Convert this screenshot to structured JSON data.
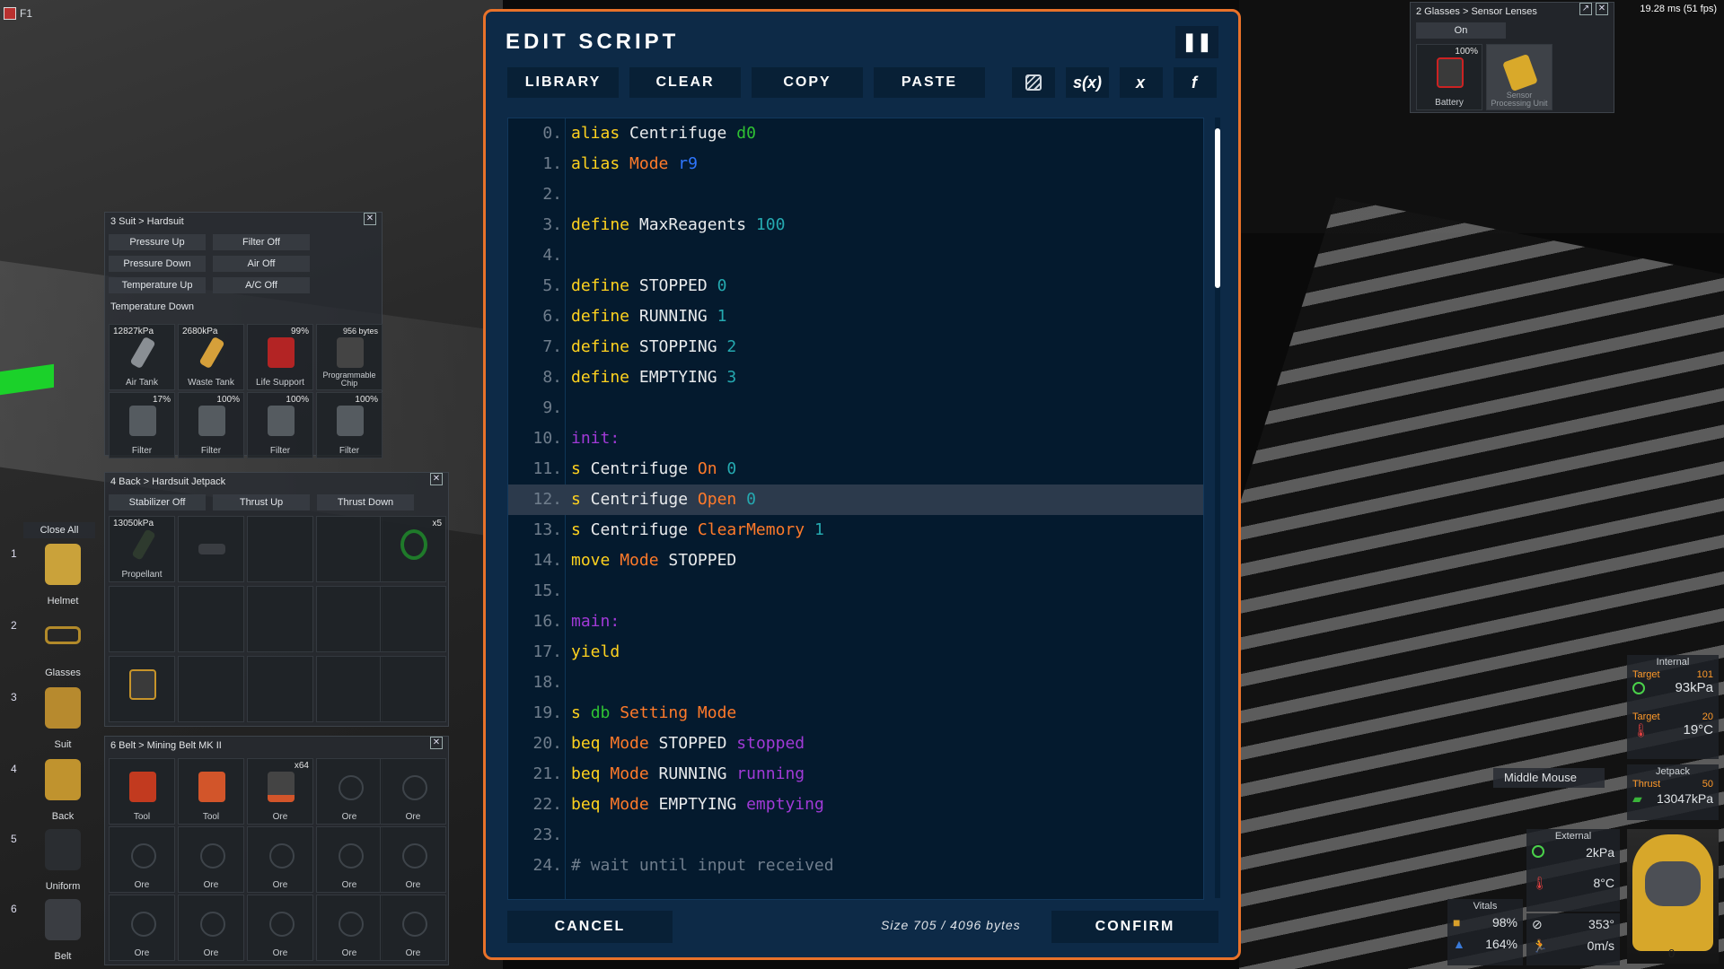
{
  "top_left": {
    "key": "F1"
  },
  "fps": "19.28 ms (51 fps)",
  "glasses_panel": {
    "title": "2 Glasses > Sensor Lenses",
    "toggle": "On",
    "slots": [
      {
        "label": "Battery",
        "value": "100%"
      },
      {
        "label": "Sensor Processing Unit",
        "value": ""
      }
    ]
  },
  "suit_panel": {
    "title": "3 Suit > Hardsuit",
    "buttons": [
      "Pressure Up",
      "Filter Off",
      "Pressure Down",
      "Air Off",
      "Temperature Up",
      "A/C Off",
      "Temperature Down"
    ],
    "slots": [
      {
        "label": "Air Tank",
        "value": "12827kPa"
      },
      {
        "label": "Waste Tank",
        "value": "2680kPa"
      },
      {
        "label": "Life Support",
        "value": "99%"
      },
      {
        "label": "Programmable Chip",
        "value": "956 bytes"
      },
      {
        "label": "Filter",
        "value": "17%"
      },
      {
        "label": "Filter",
        "value": "100%"
      },
      {
        "label": "Filter",
        "value": "100%"
      },
      {
        "label": "Filter",
        "value": "100%"
      }
    ]
  },
  "jetpack_panel": {
    "title": "4 Back > Hardsuit Jetpack",
    "buttons": [
      "Stabilizer Off",
      "Thrust Up",
      "Thrust Down"
    ],
    "slots": [
      {
        "label": "Propellant",
        "value": "13050kPa"
      },
      {
        "label": "",
        "value": "x5"
      }
    ]
  },
  "belt_panel": {
    "title": "6 Belt > Mining Belt MK II",
    "slots": [
      "Tool",
      "Tool",
      "Ore",
      "Ore",
      "Ore",
      "Ore",
      "Ore",
      "Ore",
      "Ore",
      "Ore",
      "Ore",
      "Ore",
      "Ore",
      "Ore",
      "Ore"
    ],
    "ore_count": "x64"
  },
  "close_all": "Close All",
  "left_bar": [
    {
      "num": "1",
      "label": "Helmet"
    },
    {
      "num": "2",
      "label": "Glasses"
    },
    {
      "num": "3",
      "label": "Suit"
    },
    {
      "num": "4",
      "label": "Back"
    },
    {
      "num": "5",
      "label": "Uniform"
    },
    {
      "num": "6",
      "label": "Belt"
    }
  ],
  "dialog": {
    "title": "EDIT SCRIPT",
    "toolbar": {
      "library": "LIBRARY",
      "clear": "CLEAR",
      "copy": "COPY",
      "paste": "PASTE",
      "sx": "s(x)",
      "x": "x",
      "f": "f"
    },
    "cancel": "CANCEL",
    "confirm": "CONFIRM",
    "size": "Size 705 / 4096 bytes",
    "highlighted_line": 12,
    "lines": [
      [
        [
          "kw",
          "alias"
        ],
        [
          "id",
          " Centrifuge "
        ],
        [
          "dev",
          "d0"
        ]
      ],
      [
        [
          "kw",
          "alias"
        ],
        [
          "id",
          " "
        ],
        [
          "lg",
          "Mode"
        ],
        [
          "id",
          " "
        ],
        [
          "reg",
          "r9"
        ]
      ],
      [],
      [
        [
          "kw",
          "define"
        ],
        [
          "id",
          " MaxReagents "
        ],
        [
          "num",
          "100"
        ]
      ],
      [],
      [
        [
          "kw",
          "define"
        ],
        [
          "id",
          " STOPPED "
        ],
        [
          "num",
          "0"
        ]
      ],
      [
        [
          "kw",
          "define"
        ],
        [
          "id",
          " RUNNING "
        ],
        [
          "num",
          "1"
        ]
      ],
      [
        [
          "kw",
          "define"
        ],
        [
          "id",
          " STOPPING "
        ],
        [
          "num",
          "2"
        ]
      ],
      [
        [
          "kw",
          "define"
        ],
        [
          "id",
          " EMPTYING "
        ],
        [
          "num",
          "3"
        ]
      ],
      [],
      [
        [
          "lbl",
          "init:"
        ]
      ],
      [
        [
          "kw",
          "s"
        ],
        [
          "id",
          " Centrifuge "
        ],
        [
          "lg",
          "On"
        ],
        [
          "id",
          " "
        ],
        [
          "num",
          "0"
        ]
      ],
      [
        [
          "kw",
          "s"
        ],
        [
          "id",
          " Centrifuge "
        ],
        [
          "lg",
          "Open"
        ],
        [
          "id",
          " "
        ],
        [
          "num",
          "0"
        ]
      ],
      [
        [
          "kw",
          "s"
        ],
        [
          "id",
          " Centrifuge "
        ],
        [
          "lg",
          "ClearMemory"
        ],
        [
          "id",
          " "
        ],
        [
          "num",
          "1"
        ]
      ],
      [
        [
          "kw",
          "move"
        ],
        [
          "id",
          " "
        ],
        [
          "lg",
          "Mode"
        ],
        [
          "id",
          " STOPPED"
        ]
      ],
      [],
      [
        [
          "lbl",
          "main:"
        ]
      ],
      [
        [
          "kw",
          "yield"
        ]
      ],
      [],
      [
        [
          "kw",
          "s"
        ],
        [
          "id",
          " "
        ],
        [
          "dev",
          "db"
        ],
        [
          "id",
          " "
        ],
        [
          "lg",
          "Setting"
        ],
        [
          "id",
          " "
        ],
        [
          "lg",
          "Mode"
        ]
      ],
      [
        [
          "kw",
          "beq"
        ],
        [
          "id",
          " "
        ],
        [
          "lg",
          "Mode"
        ],
        [
          "id",
          " STOPPED "
        ],
        [
          "lbl",
          "stopped"
        ]
      ],
      [
        [
          "kw",
          "beq"
        ],
        [
          "id",
          " "
        ],
        [
          "lg",
          "Mode"
        ],
        [
          "id",
          " RUNNING "
        ],
        [
          "lbl",
          "running"
        ]
      ],
      [
        [
          "kw",
          "beq"
        ],
        [
          "id",
          " "
        ],
        [
          "lg",
          "Mode"
        ],
        [
          "id",
          " EMPTYING "
        ],
        [
          "lbl",
          "emptying"
        ]
      ],
      [],
      [
        [
          "cmt",
          "# wait until input received"
        ]
      ]
    ]
  },
  "hud": {
    "internal": {
      "title": "Internal",
      "target_label": "Target",
      "target_p": "101",
      "pressure": "93kPa",
      "target_t": "20",
      "temp": "19°C"
    },
    "jetpack": {
      "title": "Jetpack",
      "thrust_label": "Thrust",
      "thrust": "50",
      "pressure": "13047kPa"
    },
    "external": {
      "title": "External",
      "pressure": "2kPa",
      "temp": "8°C"
    },
    "vitals": {
      "title": "Vitals",
      "food": "98%",
      "water": "164%"
    },
    "compass": "353°",
    "speed": "0m/s",
    "helmet_count": "0",
    "middle_mouse": "Middle Mouse"
  }
}
